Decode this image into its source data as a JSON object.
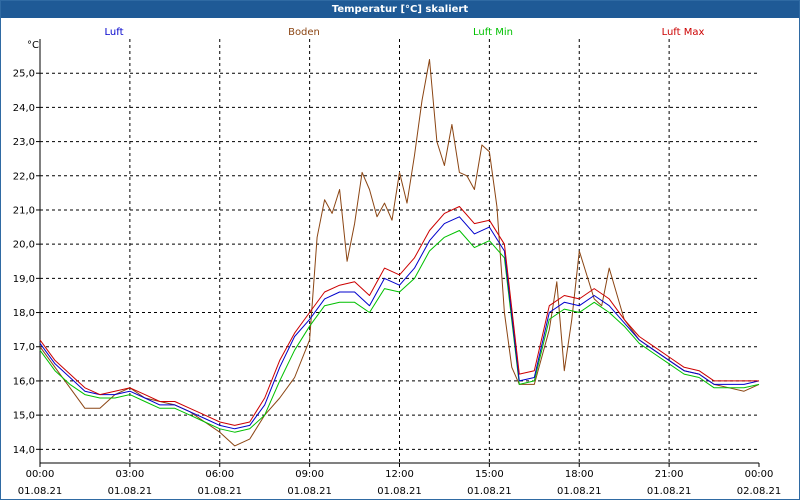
{
  "chart_data": {
    "type": "line",
    "title": "Temperatur [°C] skaliert",
    "ylabel": "°C",
    "ylim": [
      13.6,
      26.0
    ],
    "xlim": [
      "01.08.21 00:00",
      "02.08.21 00:00"
    ],
    "yticks": [
      14.0,
      15.0,
      16.0,
      17.0,
      18.0,
      19.0,
      20.0,
      21.0,
      22.0,
      23.0,
      24.0,
      25.0
    ],
    "ytick_labels": [
      "14,0",
      "15,0",
      "16,0",
      "17,0",
      "18,0",
      "19,0",
      "20,0",
      "21,0",
      "22,0",
      "23,0",
      "24,0",
      "25,0"
    ],
    "xticks": [
      {
        "time": "00:00",
        "date": "01.08.21"
      },
      {
        "time": "03:00",
        "date": "01.08.21"
      },
      {
        "time": "06:00",
        "date": "01.08.21"
      },
      {
        "time": "09:00",
        "date": "01.08.21"
      },
      {
        "time": "12:00",
        "date": "01.08.21"
      },
      {
        "time": "15:00",
        "date": "01.08.21"
      },
      {
        "time": "18:00",
        "date": "01.08.21"
      },
      {
        "time": "21:00",
        "date": "01.08.21"
      },
      {
        "time": "00:00",
        "date": "02.08.21"
      }
    ],
    "grid": true,
    "legend_position": "top",
    "series": [
      {
        "name": "Luft",
        "color": "#0000cc",
        "x": [
          "00:00",
          "00:30",
          "01:00",
          "01:30",
          "02:00",
          "02:30",
          "03:00",
          "03:30",
          "04:00",
          "04:30",
          "05:00",
          "05:30",
          "06:00",
          "06:30",
          "07:00",
          "07:30",
          "08:00",
          "08:30",
          "09:00",
          "09:30",
          "10:00",
          "10:30",
          "11:00",
          "11:30",
          "12:00",
          "12:30",
          "13:00",
          "13:30",
          "14:00",
          "14:30",
          "15:00",
          "15:30",
          "16:00",
          "16:30",
          "17:00",
          "17:30",
          "18:00",
          "18:30",
          "19:00",
          "19:30",
          "20:00",
          "20:30",
          "21:00",
          "21:30",
          "22:00",
          "22:30",
          "23:00",
          "23:30",
          "24:00"
        ],
        "y": [
          17.1,
          16.5,
          16.1,
          15.7,
          15.6,
          15.6,
          15.7,
          15.5,
          15.3,
          15.3,
          15.1,
          14.9,
          14.7,
          14.6,
          14.7,
          15.3,
          16.4,
          17.3,
          17.8,
          18.4,
          18.6,
          18.6,
          18.2,
          19.0,
          18.8,
          19.3,
          20.1,
          20.6,
          20.8,
          20.3,
          20.5,
          19.8,
          16.0,
          16.1,
          18.0,
          18.3,
          18.2,
          18.5,
          18.2,
          17.7,
          17.2,
          16.9,
          16.6,
          16.3,
          16.2,
          15.9,
          15.9,
          15.9,
          16.0
        ]
      },
      {
        "name": "Boden",
        "color": "#8b4513",
        "x": [
          "00:00",
          "00:30",
          "01:00",
          "01:30",
          "02:00",
          "02:30",
          "03:00",
          "03:30",
          "04:00",
          "04:30",
          "05:00",
          "05:30",
          "06:00",
          "06:30",
          "07:00",
          "07:30",
          "08:00",
          "08:30",
          "09:00",
          "09:15",
          "09:30",
          "09:45",
          "10:00",
          "10:15",
          "10:30",
          "10:45",
          "11:00",
          "11:15",
          "11:30",
          "11:45",
          "12:00",
          "12:15",
          "12:30",
          "12:45",
          "13:00",
          "13:15",
          "13:30",
          "13:45",
          "14:00",
          "14:15",
          "14:30",
          "14:45",
          "15:00",
          "15:15",
          "15:30",
          "15:45",
          "16:00",
          "16:30",
          "17:00",
          "17:15",
          "17:30",
          "17:45",
          "18:00",
          "18:30",
          "18:45",
          "19:00",
          "19:30",
          "20:00",
          "20:30",
          "21:00",
          "21:30",
          "22:00",
          "22:30",
          "23:00",
          "23:30",
          "24:00"
        ],
        "y": [
          17.0,
          16.4,
          15.8,
          15.2,
          15.2,
          15.6,
          15.8,
          15.5,
          15.4,
          15.3,
          15.1,
          14.8,
          14.5,
          14.1,
          14.3,
          15.0,
          15.5,
          16.1,
          17.2,
          20.2,
          21.3,
          20.9,
          21.6,
          19.5,
          20.6,
          22.1,
          21.6,
          20.8,
          21.2,
          20.7,
          22.1,
          21.2,
          22.6,
          24.2,
          25.4,
          23.0,
          22.3,
          23.5,
          22.1,
          22.0,
          21.6,
          22.9,
          22.7,
          21.1,
          18.0,
          16.4,
          15.9,
          15.9,
          17.5,
          18.9,
          16.3,
          17.8,
          19.8,
          18.4,
          18.2,
          19.3,
          17.8,
          17.2,
          16.9,
          16.6,
          16.3,
          16.2,
          15.9,
          15.8,
          15.7,
          15.9
        ]
      },
      {
        "name": "Luft Min",
        "color": "#00c000",
        "x": [
          "00:00",
          "00:30",
          "01:00",
          "01:30",
          "02:00",
          "02:30",
          "03:00",
          "03:30",
          "04:00",
          "04:30",
          "05:00",
          "05:30",
          "06:00",
          "06:30",
          "07:00",
          "07:30",
          "08:00",
          "08:30",
          "09:00",
          "09:30",
          "10:00",
          "10:30",
          "11:00",
          "11:30",
          "12:00",
          "12:30",
          "13:00",
          "13:30",
          "14:00",
          "14:30",
          "15:00",
          "15:30",
          "16:00",
          "16:30",
          "17:00",
          "17:30",
          "18:00",
          "18:30",
          "19:00",
          "19:30",
          "20:00",
          "20:30",
          "21:00",
          "21:30",
          "22:00",
          "22:30",
          "23:00",
          "23:30",
          "24:00"
        ],
        "y": [
          16.9,
          16.3,
          15.9,
          15.6,
          15.5,
          15.5,
          15.6,
          15.4,
          15.2,
          15.2,
          15.0,
          14.8,
          14.6,
          14.5,
          14.6,
          15.0,
          16.0,
          16.9,
          17.6,
          18.2,
          18.3,
          18.3,
          18.0,
          18.7,
          18.6,
          19.0,
          19.8,
          20.2,
          20.4,
          19.9,
          20.1,
          19.6,
          15.9,
          16.0,
          17.8,
          18.1,
          18.0,
          18.3,
          18.0,
          17.6,
          17.1,
          16.8,
          16.5,
          16.2,
          16.1,
          15.8,
          15.8,
          15.8,
          15.9
        ]
      },
      {
        "name": "Luft Max",
        "color": "#cc0000",
        "x": [
          "00:00",
          "00:30",
          "01:00",
          "01:30",
          "02:00",
          "02:30",
          "03:00",
          "03:30",
          "04:00",
          "04:30",
          "05:00",
          "05:30",
          "06:00",
          "06:30",
          "07:00",
          "07:30",
          "08:00",
          "08:30",
          "09:00",
          "09:30",
          "10:00",
          "10:30",
          "11:00",
          "11:30",
          "12:00",
          "12:30",
          "13:00",
          "13:30",
          "14:00",
          "14:30",
          "15:00",
          "15:30",
          "16:00",
          "16:30",
          "17:00",
          "17:30",
          "18:00",
          "18:30",
          "19:00",
          "19:30",
          "20:00",
          "20:30",
          "21:00",
          "21:30",
          "22:00",
          "22:30",
          "23:00",
          "23:30",
          "24:00"
        ],
        "y": [
          17.2,
          16.6,
          16.2,
          15.8,
          15.6,
          15.7,
          15.8,
          15.6,
          15.4,
          15.4,
          15.2,
          15.0,
          14.8,
          14.7,
          14.8,
          15.5,
          16.6,
          17.4,
          18.0,
          18.6,
          18.8,
          18.9,
          18.5,
          19.3,
          19.1,
          19.6,
          20.4,
          20.9,
          21.1,
          20.6,
          20.7,
          20.0,
          16.2,
          16.3,
          18.2,
          18.5,
          18.4,
          18.7,
          18.4,
          17.8,
          17.3,
          17.0,
          16.7,
          16.4,
          16.3,
          16.0,
          16.0,
          16.0,
          16.0
        ]
      }
    ]
  }
}
